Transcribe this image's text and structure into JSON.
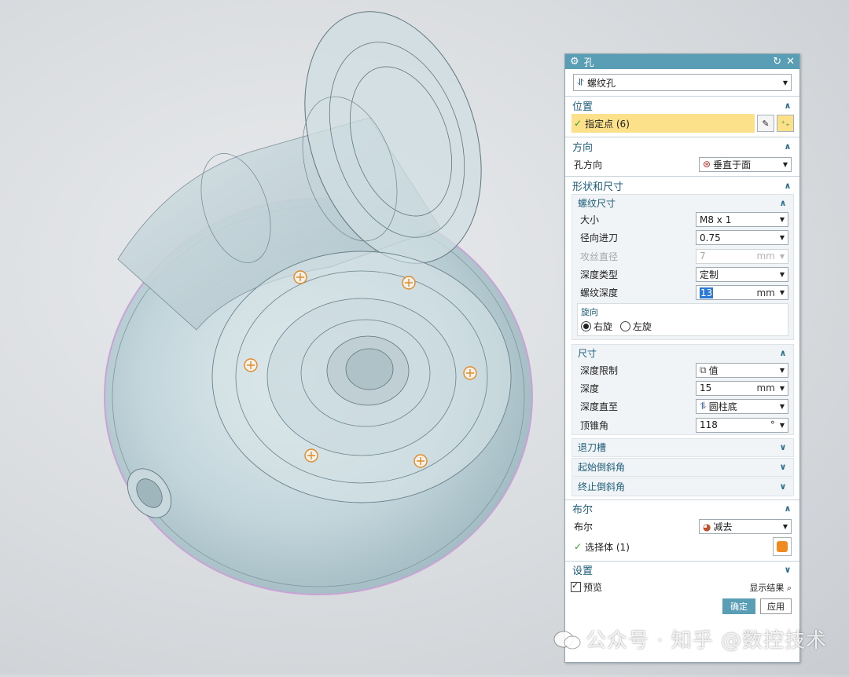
{
  "dialog": {
    "title": "孔",
    "type_value": "螺纹孔",
    "position": {
      "header": "位置",
      "specify_points": "指定点 (6)"
    },
    "direction": {
      "header": "方向",
      "label": "孔方向",
      "value": "垂直于面"
    },
    "shape": {
      "header": "形状和尺寸",
      "thread": {
        "header": "螺纹尺寸",
        "size_label": "大小",
        "size_value": "M8 x 1",
        "radial_label": "径向进刀",
        "radial_value": "0.75",
        "tap_label": "攻丝直径",
        "tap_value": "7",
        "tap_unit": "mm",
        "depth_type_label": "深度类型",
        "depth_type_value": "定制",
        "thread_depth_label": "螺纹深度",
        "thread_depth_value": "13",
        "thread_depth_unit": "mm",
        "hand_label": "旋向",
        "right_hand": "右旋",
        "left_hand": "左旋"
      },
      "dims": {
        "header": "尺寸",
        "limit_label": "深度限制",
        "limit_value": "值",
        "depth_label": "深度",
        "depth_value": "15",
        "depth_unit": "mm",
        "depth_to_label": "深度直至",
        "depth_to_value": "圆柱底",
        "tip_label": "顶锥角",
        "tip_value": "118",
        "tip_unit": "°"
      },
      "relief": "退刀槽",
      "start_chamfer": "起始倒斜角",
      "end_chamfer": "终止倒斜角"
    },
    "boolean": {
      "header": "布尔",
      "label": "布尔",
      "value": "减去",
      "select_body": "选择体 (1)"
    },
    "settings": {
      "header": "设置"
    },
    "preview": {
      "label": "预览",
      "show_result": "显示结果"
    },
    "buttons": {
      "ok": "确定",
      "apply": "应用"
    }
  },
  "watermark": "公众号 · 知乎 @数控技术",
  "colors": {
    "title_bar": "#5a9eb5",
    "section_text": "#1d5e7a",
    "highlight": "#fde08a",
    "model": "#bfd4da"
  }
}
